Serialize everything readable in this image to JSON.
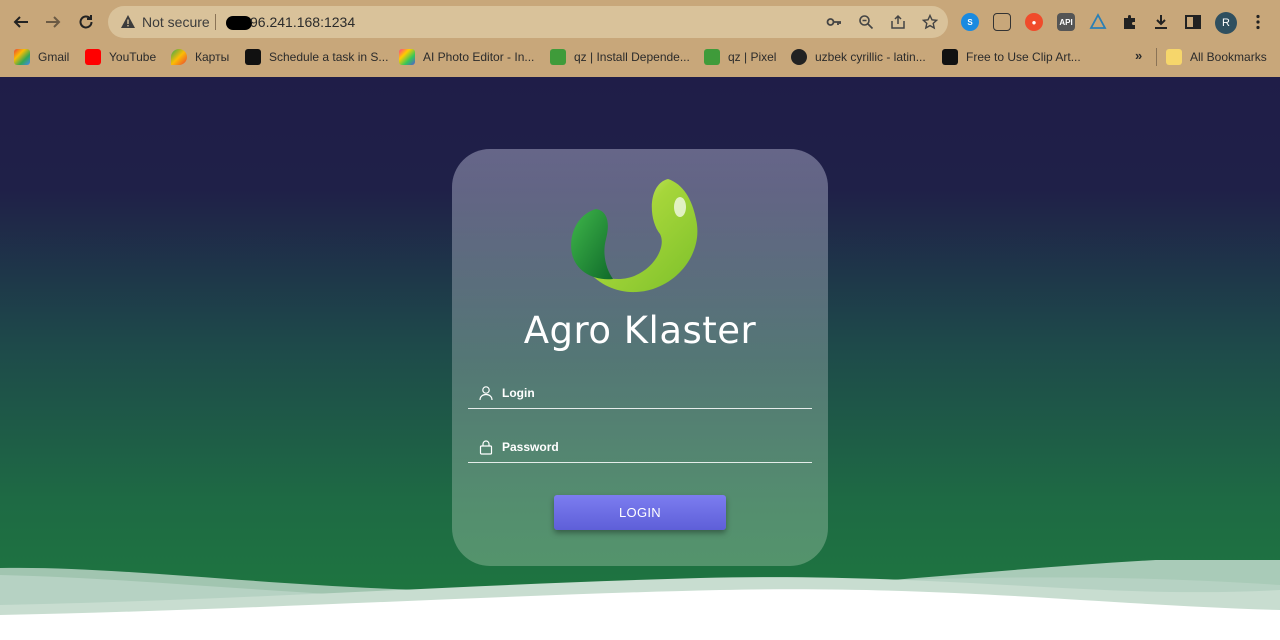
{
  "browser": {
    "security_label": "Not secure",
    "url": "96.241.168:1234",
    "avatar_letter": "R",
    "ext_api_label": "API",
    "bookmarks": [
      {
        "label": "Gmail"
      },
      {
        "label": "YouTube"
      },
      {
        "label": "Карты"
      },
      {
        "label": "Schedule a task in S..."
      },
      {
        "label": "AI Photo Editor - In..."
      },
      {
        "label": "qz | Install Depende..."
      },
      {
        "label": "qz | Pixel"
      },
      {
        "label": "uzbek cyrillic - latin..."
      },
      {
        "label": "Free to Use Clip Art..."
      }
    ],
    "more_bookmarks": "»",
    "all_bookmarks": "All Bookmarks"
  },
  "login": {
    "brand": "Agro Klaster",
    "login_placeholder": "Login",
    "password_placeholder": "Password",
    "submit_label": "LOGIN"
  },
  "colors": {
    "chrome": "#c8a77a",
    "bg_top": "#1f1d48",
    "bg_bottom": "#1e7a3e",
    "button": "#6b6ce6"
  }
}
